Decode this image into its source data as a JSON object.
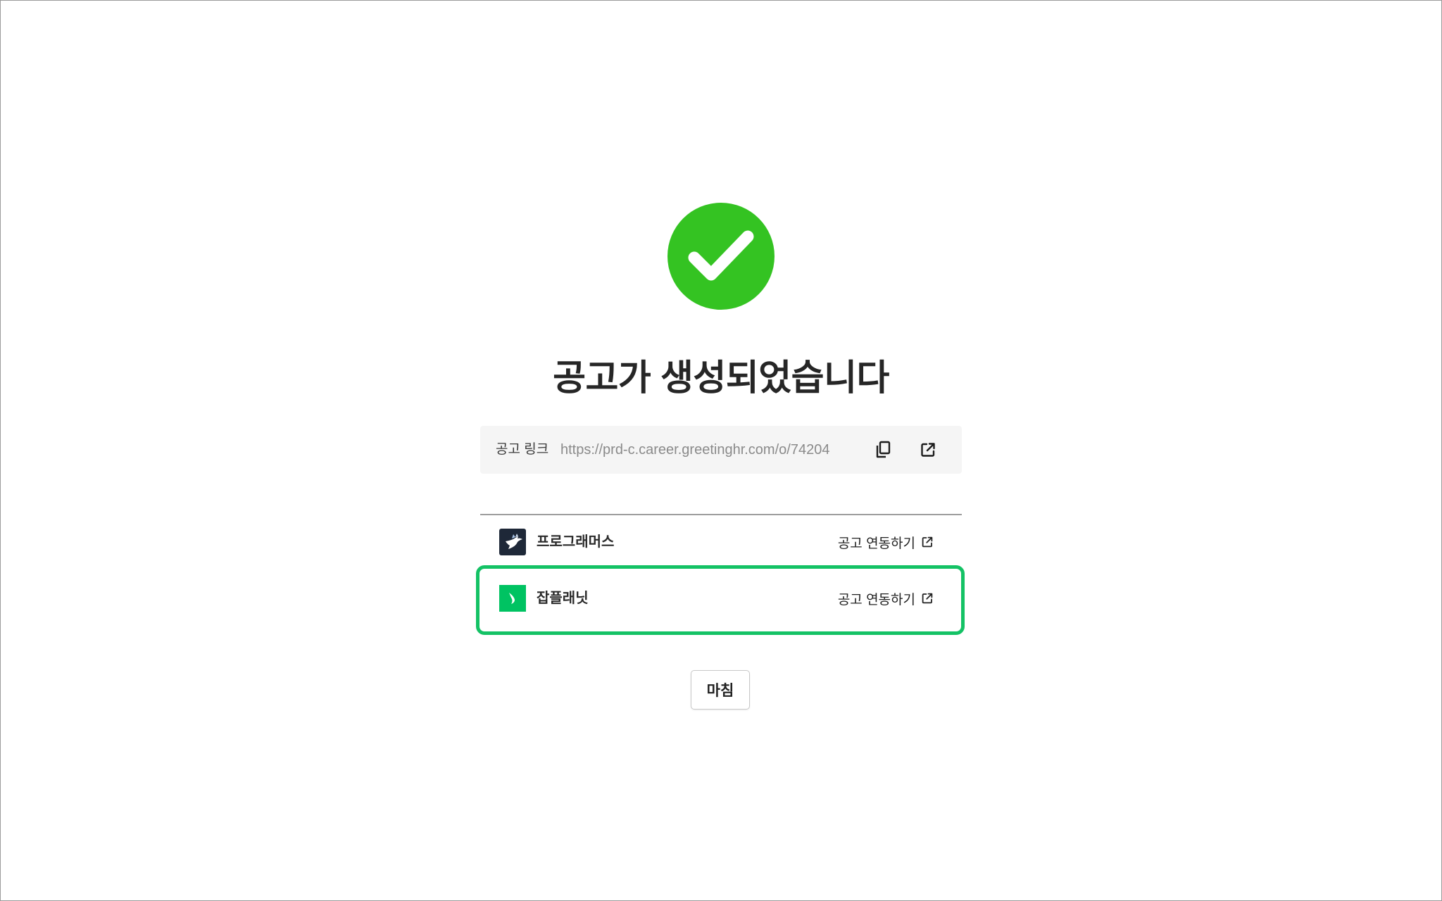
{
  "title": "공고가 생성되었습니다",
  "link": {
    "label": "공고 링크",
    "url": "https://prd-c.career.greetinghr.com/o/74204",
    "copy_icon": "copy-icon",
    "open_icon": "external-link-icon"
  },
  "platforms": [
    {
      "name": "프로그래머스",
      "action_label": "공고 연동하기",
      "logo_icon": "programmers-logo-icon",
      "logo_color": "#1e2838"
    },
    {
      "name": "잡플래닛",
      "action_label": "공고 연동하기",
      "logo_icon": "jobplanet-logo-icon",
      "logo_color": "#00c362",
      "highlighted": true
    }
  ],
  "finish_label": "마침",
  "colors": {
    "success": "#34c322",
    "highlight": "#14c265",
    "link_box_bg": "#f5f5f5"
  }
}
